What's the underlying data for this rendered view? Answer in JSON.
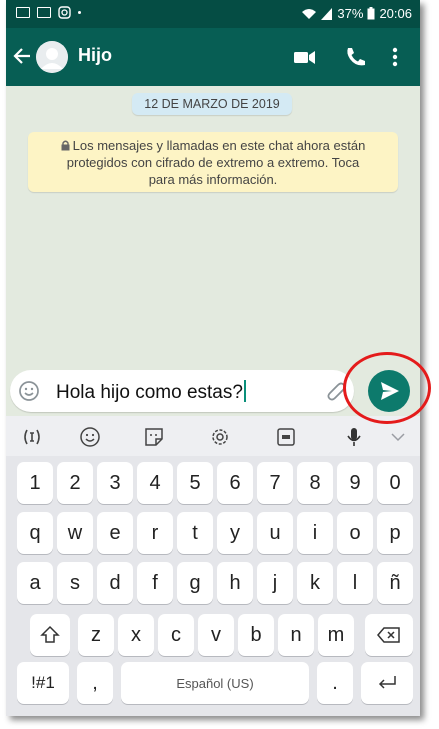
{
  "colors": {
    "header": "#075e54",
    "status_bar": "#054d44",
    "send_button": "#0d7a6c",
    "chat_bg": "#e3eadf",
    "notice_bg": "#fdf4c5",
    "date_bg": "#d4eaf4",
    "highlight_ring": "#e41b1b"
  },
  "status_bar": {
    "battery": "37%",
    "time": "20:06",
    "icons": [
      "screen-icon",
      "gallery-icon",
      "instagram-icon",
      "dot-icon",
      "wifi-icon",
      "signal-icon",
      "battery-icon"
    ]
  },
  "header": {
    "contact_name": "Hijo",
    "icons": [
      "back-arrow-icon",
      "avatar-icon",
      "video-call-icon",
      "phone-call-icon",
      "more-menu-icon"
    ]
  },
  "chat": {
    "date": "12 DE MARZO DE 2019",
    "notice_lines": [
      "Los mensajes y llamadas en este chat ahora están",
      "protegidos con cifrado de extremo a extremo. Toca",
      "para más información."
    ]
  },
  "composer": {
    "message": "Hola hijo como estas?",
    "icons": [
      "emoji-icon",
      "paperclip-icon",
      "send-icon"
    ]
  },
  "keyboard": {
    "toolbar_icons": [
      "cursor-icon",
      "emoji-icon",
      "sticker-icon",
      "settings-icon",
      "gif-icon",
      "mic-icon",
      "collapse-chevron-icon"
    ],
    "row_numbers": [
      "1",
      "2",
      "3",
      "4",
      "5",
      "6",
      "7",
      "8",
      "9",
      "0"
    ],
    "row_1": [
      "q",
      "w",
      "e",
      "r",
      "t",
      "y",
      "u",
      "i",
      "o",
      "p"
    ],
    "row_2": [
      "a",
      "s",
      "d",
      "f",
      "g",
      "h",
      "j",
      "k",
      "l",
      "ñ"
    ],
    "row_3": [
      "z",
      "x",
      "c",
      "v",
      "b",
      "n",
      "m"
    ],
    "symbols_key": "!#1",
    "comma_key": ",",
    "space_label": "Español (US)",
    "period_key": "."
  }
}
